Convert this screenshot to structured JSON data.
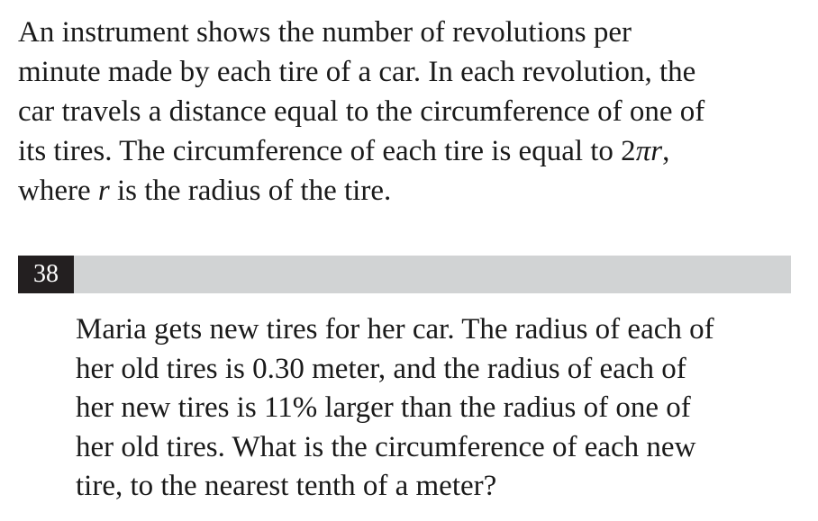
{
  "intro": {
    "line1": "An instrument shows the number of revolutions per",
    "line2": "minute made by each tire of a car. In each revolution, the",
    "line3": "car travels a distance equal to the circumference of one of",
    "line4_pre": "its tires. The circumference of each tire is equal to 2",
    "line4_var": "πr",
    "line4_post": ",",
    "line5_pre": "where ",
    "line5_var": "r",
    "line5_post": " is the radius of the tire."
  },
  "question": {
    "number": "38",
    "line1": "Maria gets new tires for her car. The radius of each of",
    "line2": "her old tires is 0.30 meter, and the radius of each of",
    "line3": "her new tires is 11% larger than the radius of one of",
    "line4": "her old tires. What is the circumference of each new",
    "line5": "tire, to the nearest tenth of a meter?"
  },
  "colors": {
    "bar": "#d1d3d4",
    "number_box": "#231f20",
    "text": "#1a1a1a"
  }
}
